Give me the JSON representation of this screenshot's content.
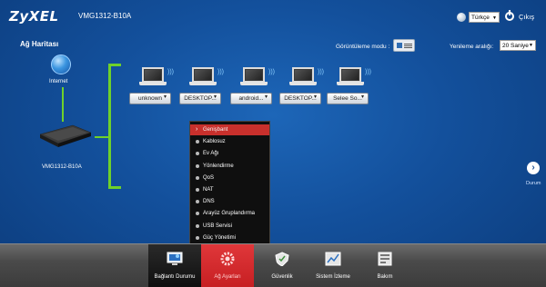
{
  "brand": {
    "logo": "ZyXEL",
    "model": "VMG1312-B10A"
  },
  "header": {
    "language": {
      "icon": "globe-icon",
      "selected": "Türkçe"
    },
    "logout": {
      "icon": "power-icon",
      "label": "Çıkış"
    }
  },
  "page": {
    "title": "Ağ Haritası",
    "view_mode_label": "Görüntüleme modu :",
    "refresh_label": "Yenileme aralığı:",
    "refresh_selected": "20 Saniye"
  },
  "network": {
    "internet_label": "Internet",
    "router_label": "VMG1312-B10A",
    "devices": [
      {
        "label": "unknown"
      },
      {
        "label": "DESKTOP..."
      },
      {
        "label": "android..."
      },
      {
        "label": "DESKTOP..."
      },
      {
        "label": "Selee So..."
      }
    ],
    "link_color": "#6fd12a"
  },
  "menu": {
    "items": [
      {
        "label": "Genişbant",
        "active": true
      },
      {
        "label": "Kablosuz"
      },
      {
        "label": "Ev Ağı"
      },
      {
        "label": "Yönlendirme"
      },
      {
        "label": "QoS"
      },
      {
        "label": "NAT"
      },
      {
        "label": "DNS"
      },
      {
        "label": "Arayüz Gruplandırma"
      },
      {
        "label": "USB Servisi"
      },
      {
        "label": "Güç Yönetimi"
      }
    ],
    "active_color": "#c8302c"
  },
  "side": {
    "next_label": "Durum"
  },
  "bottom_nav": [
    {
      "label": "Bağlantı Durumu",
      "icon": "monitor-icon"
    },
    {
      "label": "Ağ Ayarları",
      "icon": "gear-icon"
    },
    {
      "label": "Güvenlik",
      "icon": "shield-icon"
    },
    {
      "label": "Sistem İzleme",
      "icon": "chart-icon"
    },
    {
      "label": "Bakım",
      "icon": "tools-icon"
    }
  ]
}
